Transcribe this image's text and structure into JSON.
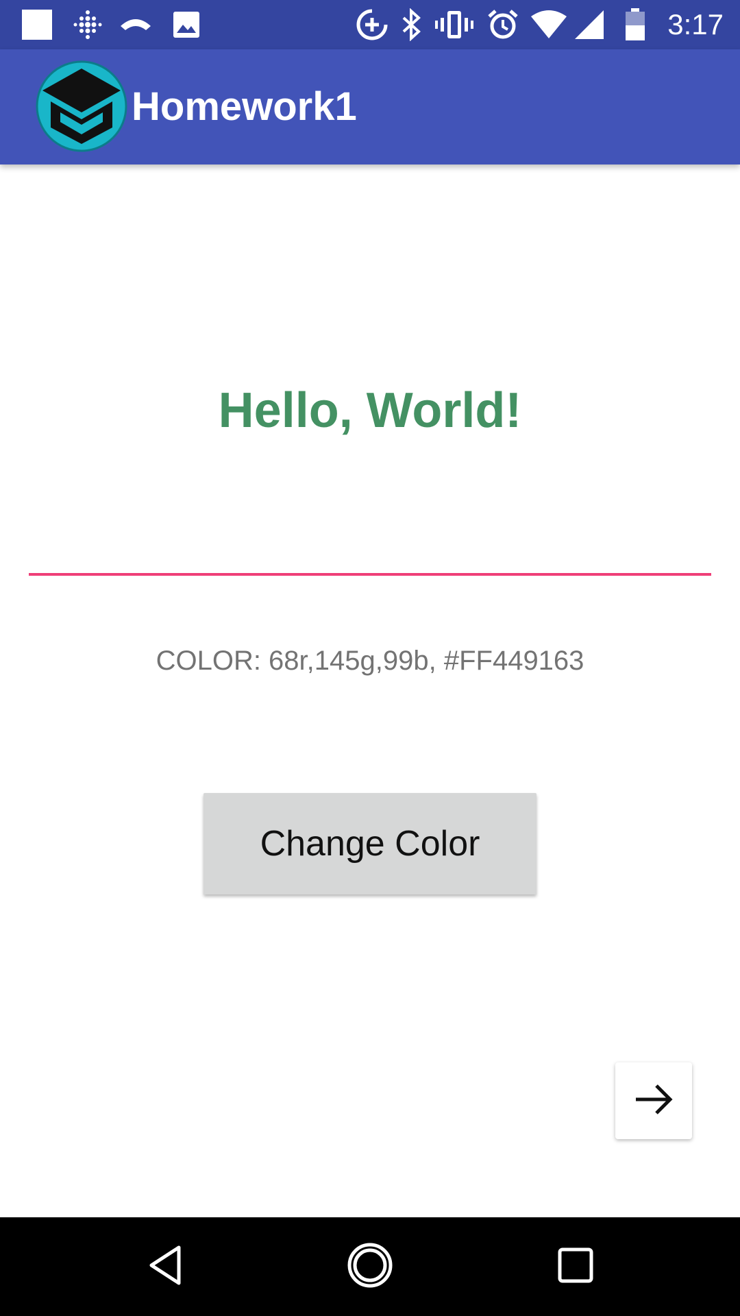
{
  "status_bar": {
    "time": "3:17",
    "icons": [
      "notification-square-icon",
      "fitbit-icon",
      "call-icon",
      "image-icon",
      "data-saver-icon",
      "bluetooth-icon",
      "vibrate-icon",
      "alarm-icon",
      "wifi-icon",
      "signal-icon",
      "battery-icon"
    ]
  },
  "app_bar": {
    "title": "Homework1",
    "logo_icon": "graduation-cap-icon",
    "color": "#4254b8"
  },
  "main": {
    "greeting": "Hello, World!",
    "greeting_color": "#449163",
    "input_value": "",
    "input_accent_color": "#ef3f78",
    "color_readout": "COLOR: 68r,145g,99b, #FF449163",
    "change_color_button": "Change Color",
    "next_button_icon": "arrow-right-icon"
  },
  "nav_bar": {
    "icons": [
      "back-icon",
      "home-icon",
      "recents-icon"
    ]
  }
}
